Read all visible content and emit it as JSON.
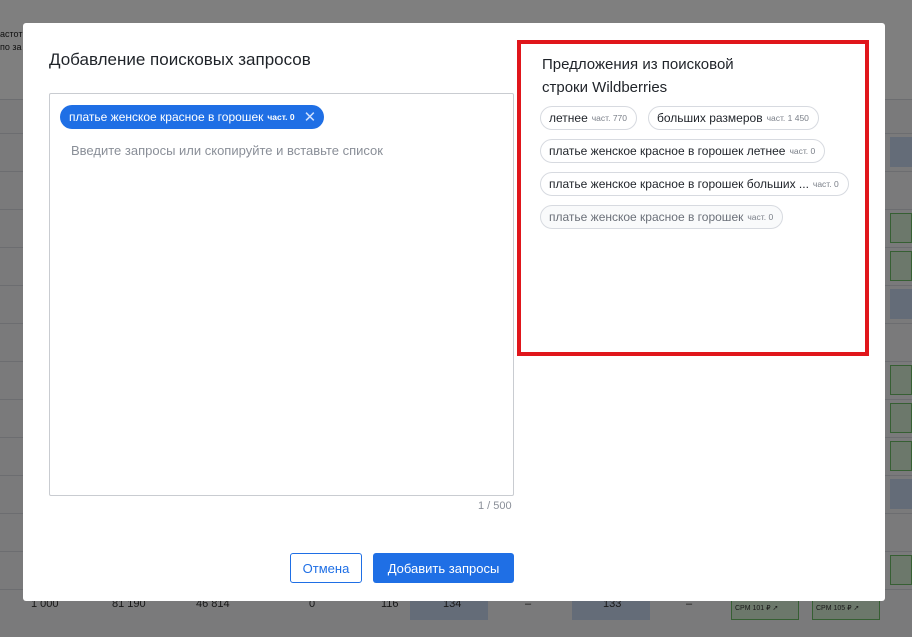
{
  "background": {
    "header_fragment_lines": [
      "астот",
      "по за"
    ],
    "bottom_row_values": [
      "1 000",
      "81 190",
      "46 814",
      "0",
      "116",
      "134",
      "–",
      "133",
      "–"
    ],
    "cpm_labels": [
      "CPM 101 ₽",
      "CPM 105 ₽"
    ]
  },
  "modal": {
    "title": "Добавление поисковых запросов",
    "selected_query": {
      "text": "платье женское красное в горошек",
      "freq": "част. 0"
    },
    "input_placeholder": "Введите запросы или скопируйте и вставьте список",
    "counter": "1 / 500",
    "suggestions": {
      "title_line1": "Предложения из поисковой",
      "title_line2": "строки Wildberries",
      "items": [
        {
          "text": "летнее",
          "freq": "част. 770"
        },
        {
          "text": "больших размеров",
          "freq": "част. 1 450"
        },
        {
          "text": "платье женское красное в горошек летнее",
          "freq": "част. 0"
        },
        {
          "text": "платье женское красное в горошек больших ...",
          "freq": "част. 0"
        },
        {
          "text": "платье женское красное в горошек",
          "freq": "част. 0"
        }
      ]
    },
    "cancel_label": "Отмена",
    "submit_label": "Добавить запросы"
  },
  "colors": {
    "accent": "#1f6fe5",
    "highlight_border": "#e0161b"
  }
}
